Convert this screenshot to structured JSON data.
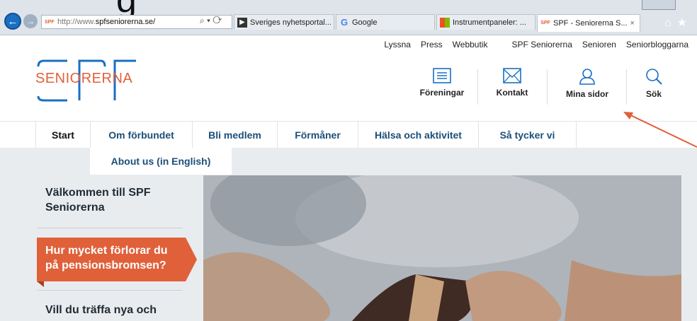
{
  "browser": {
    "address": {
      "favicon_text": "SPF",
      "url_prefix": "http://www.",
      "url_domain": "spfseniorerna.se/",
      "tools": "⌕ ▾ ⟳"
    },
    "tabs": [
      {
        "label": "Sveriges nyhetsportal...",
        "icon": "news-icon"
      },
      {
        "label": "Google",
        "icon": "google-icon"
      },
      {
        "label": "Instrumentpaneler: ...",
        "icon": "windows-icon"
      },
      {
        "label": "SPF - Seniorerna S...",
        "icon": "spf-icon",
        "active": true,
        "close": "×"
      }
    ],
    "heading_fragment": "g"
  },
  "utility_nav": [
    "Lyssna",
    "Press",
    "Webbutik",
    "SPF Seniorerna",
    "Senioren",
    "Seniorbloggarna"
  ],
  "logo": {
    "text": "SENIORERNA",
    "color": "#e0603a"
  },
  "header_icons": [
    {
      "label": "Föreningar",
      "icon": "list-icon"
    },
    {
      "label": "Kontakt",
      "icon": "mail-icon"
    },
    {
      "label": "Mina sidor",
      "icon": "user-icon"
    },
    {
      "label": "Sök",
      "icon": "search-icon"
    }
  ],
  "main_nav": [
    {
      "label": "Start",
      "active": true
    },
    {
      "label": "Om förbundet"
    },
    {
      "label": "Bli medlem"
    },
    {
      "label": "Förmåner"
    },
    {
      "label": "Hälsa och aktivitet"
    },
    {
      "label": "Så tycker vi"
    }
  ],
  "about_link": "About us (in English)",
  "sidebar": {
    "welcome": "Välkommen till SPF Seniorerna",
    "promo": "Hur mycket förlorar du på pensionsbromsen?",
    "next": "Vill du träffa nya och"
  },
  "colors": {
    "accent": "#e0603a",
    "nav_text": "#1b4f7a",
    "link_blue": "#1a6fc4"
  }
}
